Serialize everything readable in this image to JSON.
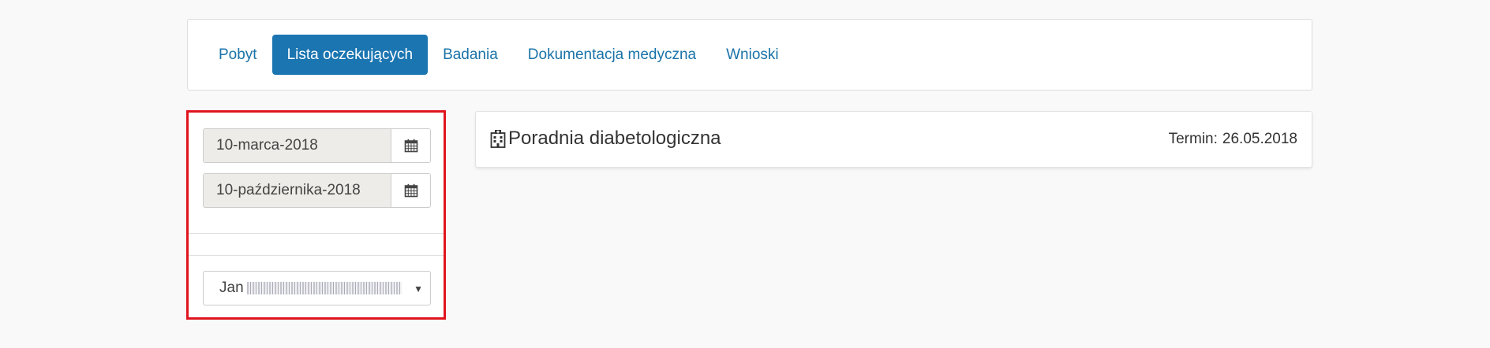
{
  "nav": {
    "tabs": [
      {
        "label": "Pobyt",
        "active": false
      },
      {
        "label": "Lista oczekujących",
        "active": true
      },
      {
        "label": "Badania",
        "active": false
      },
      {
        "label": "Dokumentacja medyczna",
        "active": false
      },
      {
        "label": "Wnioski",
        "active": false
      }
    ]
  },
  "filters": {
    "date_from": "10-marca-2018",
    "date_to": "10-października-2018",
    "patient_first_name": "Jan",
    "calendar_icon": "calendar-icon",
    "caret_icon": "caret-down-icon"
  },
  "waiting_list": {
    "clinic_icon": "hospital-icon",
    "clinic_name": "Poradnia diabetologiczna",
    "term_label": "Termin:",
    "term_date": "26.05.2018"
  },
  "colors": {
    "accent": "#1b75b1",
    "link": "#1a73a8",
    "highlight_border": "#e0141e"
  }
}
